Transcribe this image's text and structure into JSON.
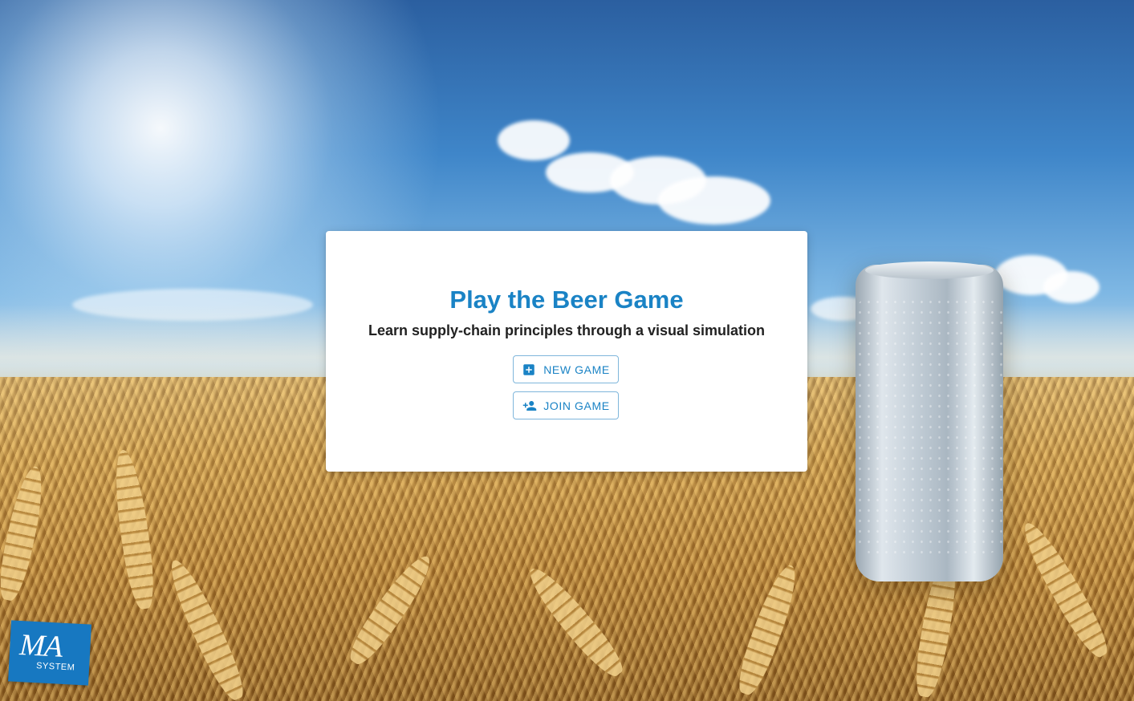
{
  "card": {
    "title": "Play the Beer Game",
    "subtitle": "Learn supply-chain principles through a visual simulation",
    "buttons": {
      "new_game": {
        "label": "NEW GAME",
        "icon": "add-box-icon"
      },
      "join_game": {
        "label": "JOIN GAME",
        "icon": "person-add-icon"
      }
    }
  },
  "logo": {
    "main": "MA",
    "sub": "SYSTEM"
  },
  "colors": {
    "accent": "#1a83c5",
    "logo_bg": "#1778c1",
    "text": "#212121"
  },
  "background": {
    "description_icon": "wheat-field-with-can-background"
  }
}
